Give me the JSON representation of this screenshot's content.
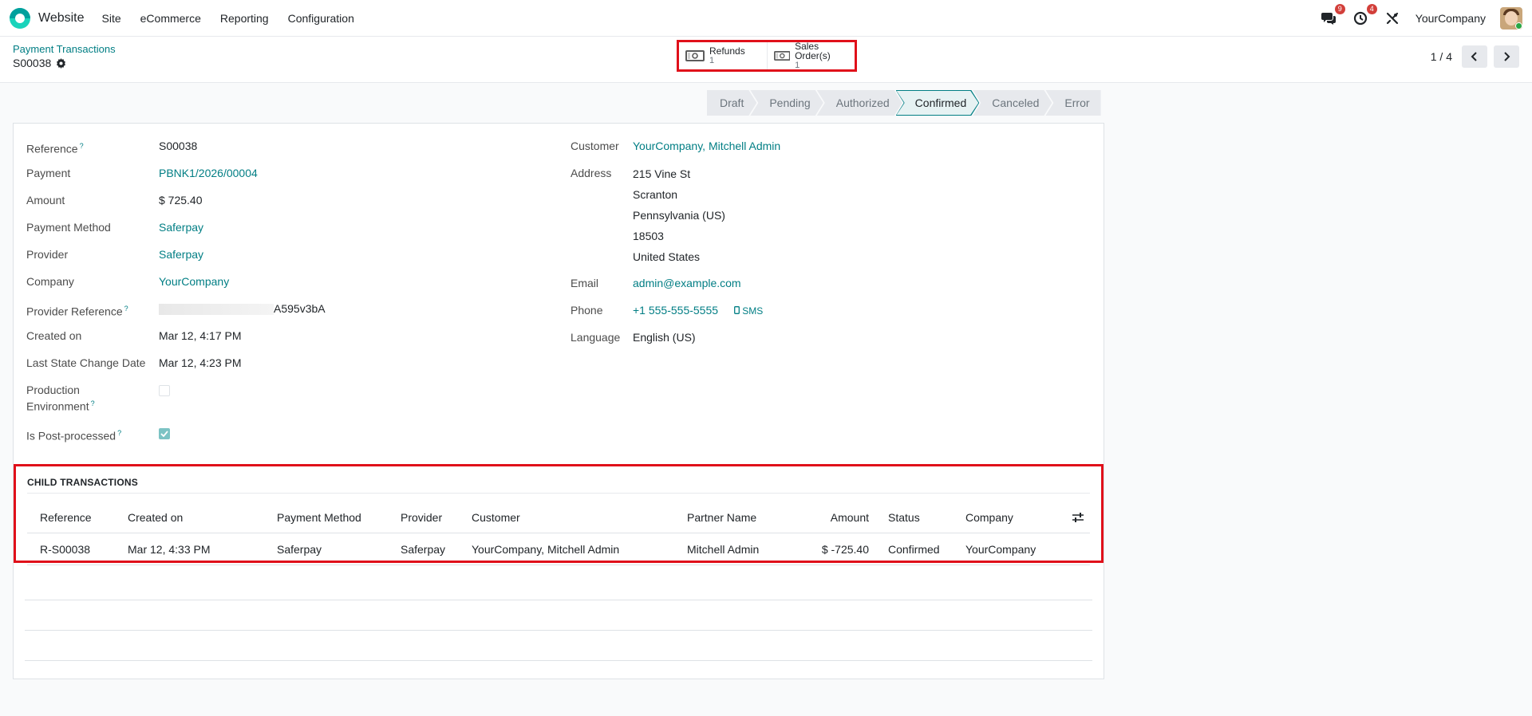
{
  "navbar": {
    "app_name": "Website",
    "menu": [
      "Site",
      "eCommerce",
      "Reporting",
      "Configuration"
    ],
    "messages_badge": "9",
    "activities_badge": "4",
    "company": "YourCompany"
  },
  "breadcrumb": {
    "parent": "Payment Transactions",
    "current": "S00038"
  },
  "smart_buttons": {
    "refunds": {
      "label": "Refunds",
      "value": "1"
    },
    "sales_orders": {
      "label": "Sales Order(s)",
      "value": "1"
    }
  },
  "pager": {
    "value": "1 / 4"
  },
  "statusbar": [
    "Draft",
    "Pending",
    "Authorized",
    "Confirmed",
    "Canceled",
    "Error"
  ],
  "left_fields": {
    "reference": {
      "label": "Reference",
      "value": "S00038"
    },
    "payment": {
      "label": "Payment",
      "value": "PBNK1/2026/00004"
    },
    "amount": {
      "label": "Amount",
      "value": "$ 725.40"
    },
    "payment_method": {
      "label": "Payment Method",
      "value": "Saferpay"
    },
    "provider": {
      "label": "Provider",
      "value": "Saferpay"
    },
    "company": {
      "label": "Company",
      "value": "YourCompany"
    },
    "provider_reference": {
      "label": "Provider Reference",
      "value": "A595v3bA"
    },
    "created_on": {
      "label": "Created on",
      "value": "Mar 12, 4:17 PM"
    },
    "last_state_change": {
      "label": "Last State Change Date",
      "value": "Mar 12, 4:23 PM"
    },
    "production_env": {
      "label_1": "Production",
      "label_2": "Environment"
    },
    "post_processed": {
      "label": "Is Post-processed"
    }
  },
  "right_fields": {
    "customer": {
      "label": "Customer",
      "value": "YourCompany, Mitchell Admin"
    },
    "address": {
      "label": "Address",
      "lines": [
        "215 Vine St",
        "Scranton",
        "Pennsylvania (US)",
        "18503",
        "United States"
      ]
    },
    "email": {
      "label": "Email",
      "value": "admin@example.com"
    },
    "phone": {
      "label": "Phone",
      "value": "+1 555-555-5555",
      "sms": "SMS"
    },
    "language": {
      "label": "Language",
      "value": "English (US)"
    }
  },
  "child_transactions": {
    "title": "CHILD TRANSACTIONS",
    "columns": [
      "Reference",
      "Created on",
      "Payment Method",
      "Provider",
      "Customer",
      "Partner Name",
      "Amount",
      "Status",
      "Company"
    ],
    "rows": [
      [
        "R-S00038",
        "Mar 12, 4:33 PM",
        "Saferpay",
        "Saferpay",
        "YourCompany, Mitchell Admin",
        "Mitchell Admin",
        "$ -725.40",
        "Confirmed",
        "YourCompany"
      ]
    ]
  },
  "colors": {
    "accent": "#017e84",
    "highlight_border": "#e0101a",
    "badge": "#d23f3a"
  }
}
